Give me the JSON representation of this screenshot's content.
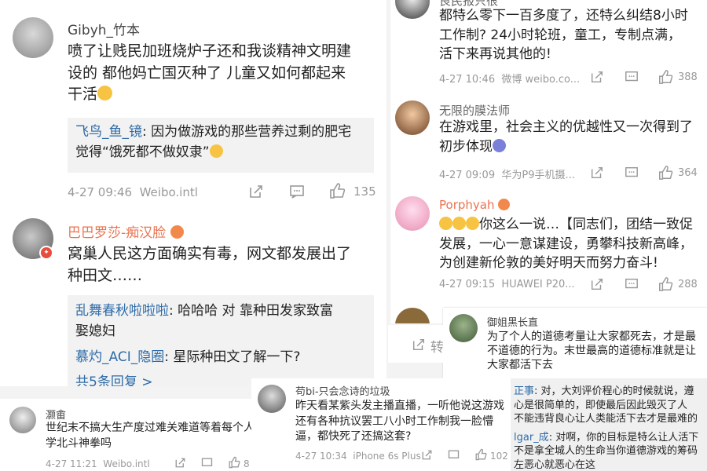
{
  "left": {
    "c1": {
      "name": "Gibyh_竹本",
      "lines": [
        "喷了让贱民加班烧炉子还和我谈精神文明建",
        "设的 都他妈亡国灭种了 儿童又如何都起来",
        "干活"
      ],
      "reply": {
        "user": "飞鸟_鱼_镜",
        "text_l1": ": 因为做游戏的那些营养过剩的肥宅",
        "text_l2": "觉得“饿死都不做奴隶”"
      },
      "time": "4-27 09:46",
      "source": "Weibo.intl",
      "likes": "135"
    },
    "c2": {
      "name": "巴巴罗莎-痴汉脸",
      "lines": [
        "窝巢人民这方面确实有毒，网文都发展出了",
        "种田文……"
      ],
      "replies": [
        {
          "user": "乱舞春秋啦啦啦",
          "t1": ": 哈哈哈 对 靠种田发家致富",
          "t2": "娶媳妇"
        },
        {
          "user": "慕灼_ACI_隐圈",
          "t1": ": 星际种田文了解一下?",
          "t2": ""
        }
      ],
      "more": "共5条回复 >"
    }
  },
  "right": {
    "c0": {
      "name": "良民报只很",
      "lines": [
        "都特么零下一百多度了，还特么纠结8小时",
        "工作制? 24小时轮班，童工，专制点满，",
        "活下来再说其他的!"
      ],
      "time": "4-27 10:46",
      "source": "微博 weibo.co...",
      "likes": "388"
    },
    "c1": {
      "name": "无限的膜法师",
      "lines": [
        "在游戏里，社会主义的优越性又一次得到了",
        "初步体现"
      ],
      "time": "4-27 09:09",
      "source": "华为P9手机摄...",
      "likes": "364"
    },
    "c2": {
      "name": "Porphyah",
      "lines": [
        "你这么一说…【同志们，团结一致促",
        "发展，一心一意谋建设，勇攀科技新高峰，",
        "为创建新伦敦的美好明天而努力奋斗!"
      ],
      "time": "4-27 09:15",
      "source": "HUAWEI P20...",
      "likes": "288"
    },
    "c3": {
      "name": "御姐黑长直",
      "lines": [
        "为了个人的道德考量让大家都死去，才是最",
        "不道德的行为。末世最高的道德标准就是让",
        "大家都活下去"
      ]
    }
  },
  "bottom": {
    "b1": {
      "name": "灏畬",
      "lines": [
        "世纪末不搞大生产度过难关难道等着每个人",
        "学北斗神拳吗"
      ],
      "time": "4-27 11:21",
      "source": "Weibo.intl",
      "likes": "8"
    },
    "b2": {
      "name": "苟bi-只会念诗的垃圾",
      "lines": [
        "昨天看某紫头发主播直播，一听他说这游戏",
        "还有各种抗议罢工八小时工作制我一脸懵",
        "逼，都快死了还搞这套?"
      ],
      "time": "4-27 10:34",
      "source": "iPhone 6s Plus",
      "likes": "102"
    },
    "b3": {
      "r1_user": "正事",
      "r1_text": ": 对，大刘评价程心的时候就说，遵",
      "r1_l2": "心是很简单的，即使最后因此毁灭了人",
      "r1_l3": "不能违背良心让人类能活下去才是最难的",
      "r2_user": "lgar_成",
      "r2_text": ": 对啊，你的目标是特么让人活下",
      "r2_l2": "不是拿全城人的生命当你道德游戏的筹码",
      "r2_l3": "左恶心就恶心在这"
    },
    "mid_frag": "转"
  }
}
